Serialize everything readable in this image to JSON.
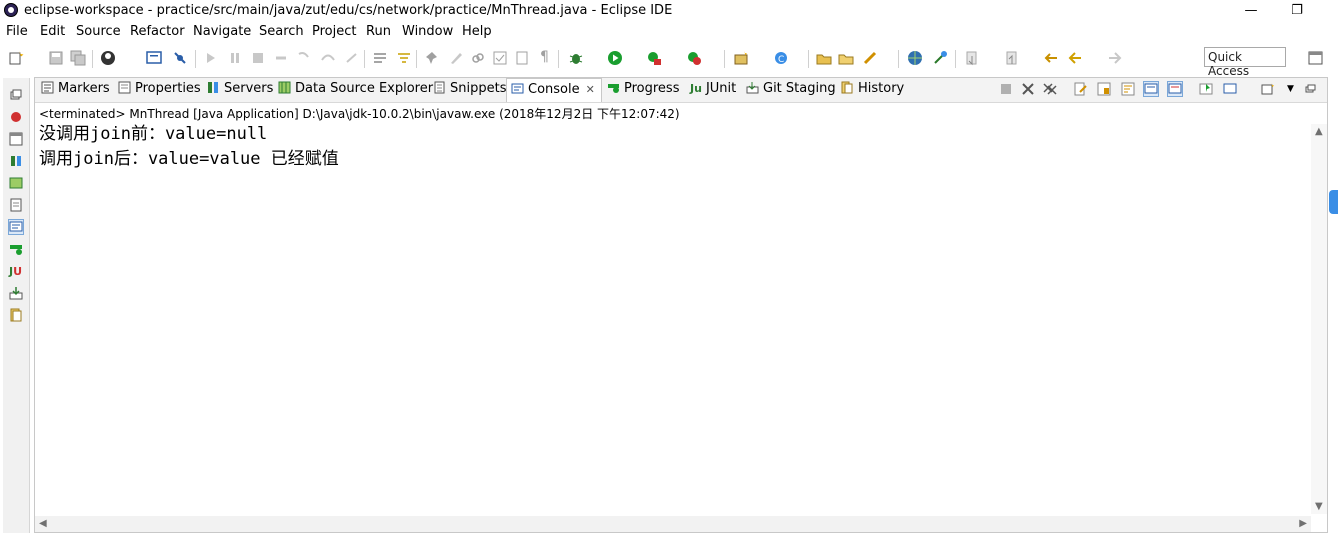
{
  "window": {
    "title": "eclipse-workspace - practice/src/main/java/zut/edu/cs/network/practice/MnThread.java - Eclipse IDE",
    "minimize_glyph": "—",
    "restore_glyph": "❐",
    "close_glyph": "✕"
  },
  "menu": [
    "File",
    "Edit",
    "Source",
    "Refactor",
    "Navigate",
    "Search",
    "Project",
    "Run",
    "Window",
    "Help"
  ],
  "quick_access": "Quick Access",
  "tabs": [
    {
      "label": "Markers",
      "icon": "markers-icon"
    },
    {
      "label": "Properties",
      "icon": "properties-icon"
    },
    {
      "label": "Servers",
      "icon": "servers-icon"
    },
    {
      "label": "Data Source Explorer",
      "icon": "data-source-explorer-icon"
    },
    {
      "label": "Snippets",
      "icon": "snippets-icon"
    },
    {
      "label": "Console",
      "icon": "console-icon",
      "active": true,
      "close_glyph": "✕"
    },
    {
      "label": "Progress",
      "icon": "progress-icon"
    },
    {
      "label": "JUnit",
      "icon": "junit-icon",
      "prefix": "Ju"
    },
    {
      "label": "Git Staging",
      "icon": "git-staging-icon"
    },
    {
      "label": "History",
      "icon": "history-icon"
    }
  ],
  "console": {
    "status": "<terminated> MnThread [Java Application] D:\\Java\\jdk-10.0.2\\bin\\javaw.exe (2018年12月2日 下午12:07:42)",
    "lines": [
      "没调用join前：value=null",
      "调用join后：value=value 已经赋值"
    ]
  },
  "colors": {
    "accent": "#3a8ee6",
    "toolbar_bg": "#ffffff",
    "tabstrip_bg": "#f3f3f3",
    "run_green": "#1a9e2f",
    "tool_red": "#d03030"
  }
}
